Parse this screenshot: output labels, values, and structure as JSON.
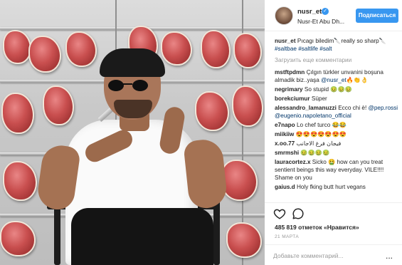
{
  "post_image": {
    "icon": "photo-of-man-with-knife"
  },
  "header": {
    "username": "nusr_et",
    "verified_icon": "check",
    "location": "Nusr-Et Abu Dh...",
    "follow_label": "Подписаться"
  },
  "caption": {
    "user": "nusr_et",
    "text": "Pıcagı biledim🔪really so sharp🔪",
    "tags": "#saltbae #saltlife #salt"
  },
  "load_more": "Загрузить еще комментарии",
  "comments": [
    {
      "user": "mstftpdmn",
      "text": "Çılgın türkler unvanini boşuna almadik biz..yaşa",
      "mention": "@nusr_et",
      "tail": "🔥👏👌"
    },
    {
      "user": "negrimary",
      "text": "So stupid 🤢🤢🤢"
    },
    {
      "user": "borekciumur",
      "text": "Süper"
    },
    {
      "user": "alessandro_lamanuzzi",
      "text": "Ecco chi è!",
      "mention": "@pep.rossi @eugenio.napoletano_official",
      "tail": ""
    },
    {
      "user": "e7napo",
      "text": "Lo chef turco 😂😂"
    },
    {
      "user": "miikiiw",
      "text": "😍😍😍😍😍😍😍"
    },
    {
      "user": "x.oo.77",
      "text": "فيجان فرغ الاجانب"
    },
    {
      "user": "smrmshi",
      "text": "🤢🤢🤢🤢"
    },
    {
      "user": "lauracortez.x",
      "text": "Sicko 🤮 how can you treat sentient beings this way everyday. VILE!!!! Shame on you"
    },
    {
      "user": "gaius.d",
      "text": "Holy fking butt hurt vegans"
    }
  ],
  "actions": {
    "like_icon": "heart-outline",
    "comment_icon": "speech-bubble",
    "likes_text": "485 819 отметок «Нравится»",
    "date": "21 МАРТА"
  },
  "add_comment": {
    "placeholder": "Добавьте комментарий...",
    "more_icon": "..."
  },
  "colors": {
    "accent": "#3897f0",
    "tag": "#003569",
    "muted": "#999999",
    "text": "#262626"
  }
}
